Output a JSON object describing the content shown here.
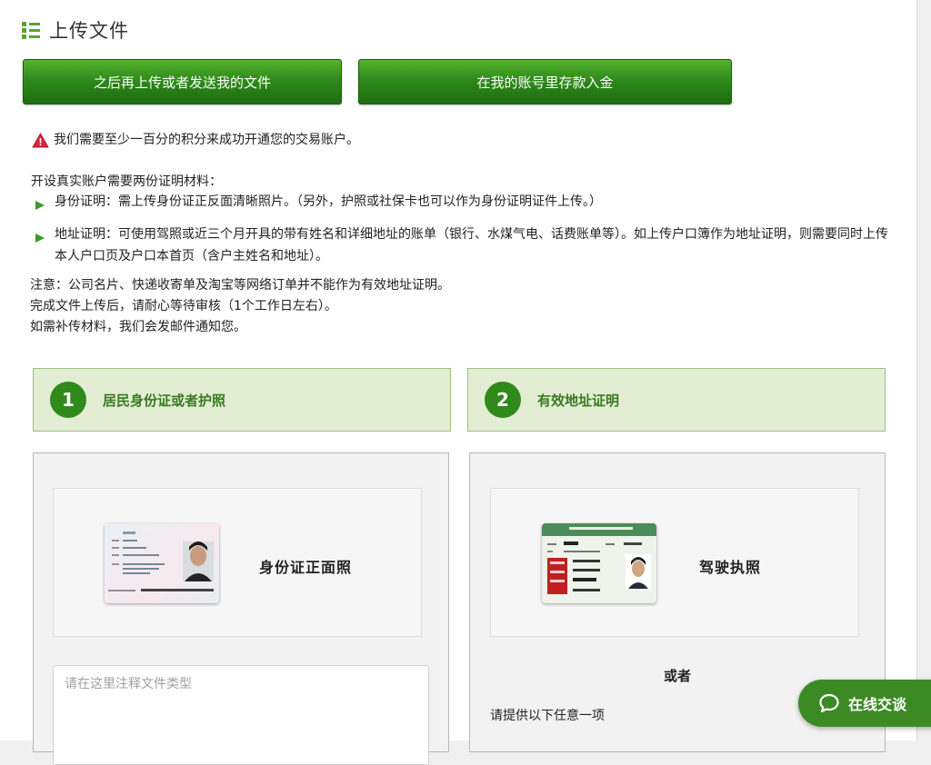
{
  "header": {
    "title": "上传文件",
    "icon": "list-icon"
  },
  "actions": {
    "upload_later": "之后再上传或者发送我的文件",
    "deposit": "在我的账号里存款入金"
  },
  "warning": {
    "icon": "warning-icon",
    "text": "我们需要至少一百分的积分来成功开通您的交易账户。"
  },
  "requirements": {
    "heading": "开设真实账户需要两份证明材料：",
    "items": [
      "身份证明：需上传身份证正反面清晰照片。（另外，护照或社保卡也可以作为身份证明证件上传。）",
      "地址证明：可使用驾照或近三个月开具的带有姓名和详细地址的账单（银行、水煤气电、话费账单等）。如上传户口簿作为地址证明，则需要同时上传本人户口页及户口本首页（含户主姓名和地址）。"
    ]
  },
  "notes": [
    "注意：公司名片、快递收寄单及淘宝等网络订单并不能作为有效地址证明。",
    "完成文件上传后，请耐心等待审核（1个工作日左右）。",
    "如需补传材料，我们会发邮件通知您。"
  ],
  "steps": [
    {
      "number": "1",
      "label": "居民身份证或者护照"
    },
    {
      "number": "2",
      "label": "有效地址证明"
    }
  ],
  "upload_id": {
    "card_label": "身份证正面照",
    "note_placeholder": "请在这里注释文件类型"
  },
  "upload_address": {
    "card_label": "驾驶执照",
    "or_text": "或者",
    "provide_text": "请提供以下任意一项"
  },
  "chat": {
    "label": "在线交谈",
    "icon": "chat-bubble-icon"
  },
  "colors": {
    "accent": "#2f8b1b",
    "step_bg": "#e2edd3",
    "warning": "#d7263d"
  }
}
